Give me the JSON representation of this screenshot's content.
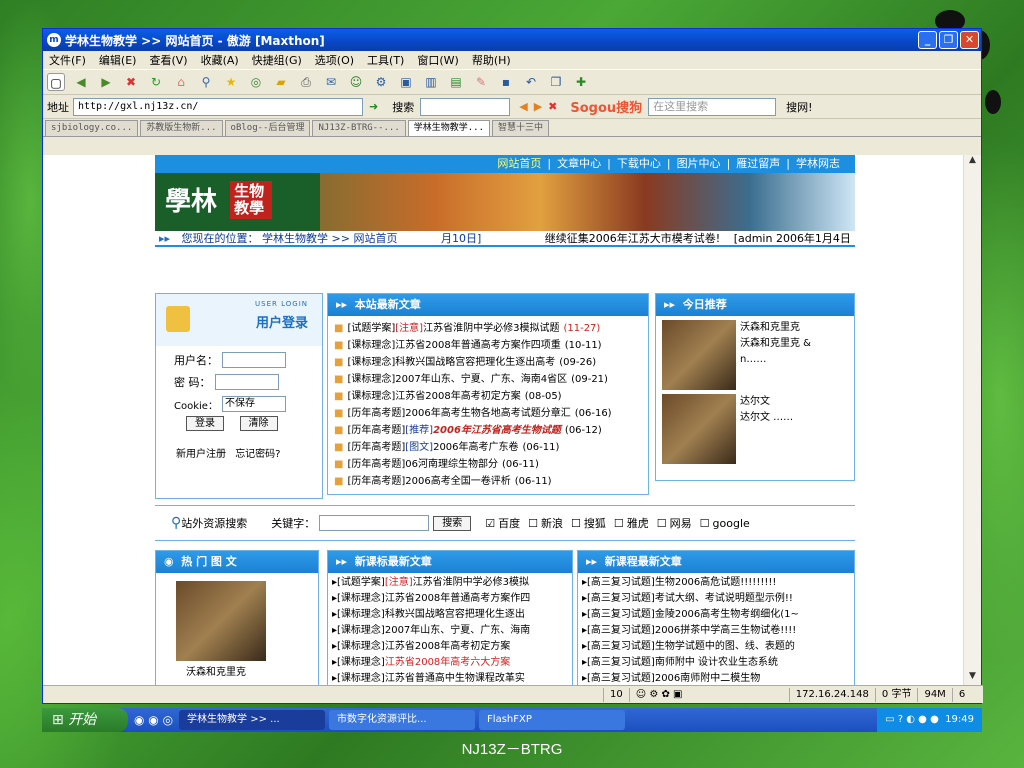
{
  "window": {
    "title": "学林生物教学 >> 网站首页 - 傲游 [Maxthon]",
    "menus": [
      "文件(F)",
      "编辑(E)",
      "查看(V)",
      "收藏(A)",
      "快捷组(G)",
      "选项(O)",
      "工具(T)",
      "窗口(W)",
      "帮助(H)"
    ],
    "address_label": "地址",
    "address_url": "http://gxl.nj13z.cn/",
    "search_label": "搜索",
    "sogou_logo": "Sogou搜狗",
    "sogou_placeholder": "在这里搜索",
    "sogou_button": "搜网!"
  },
  "tabs": [
    "sjbiology.co...",
    "苏教版生物新...",
    "oBlog--后台管理",
    "NJ13Z-BTRG--...",
    "学林生物教学...",
    "智慧十三中"
  ],
  "site": {
    "topnav": [
      "网站首页",
      "文章中心",
      "下载中心",
      "图片中心",
      "雁过留声",
      "学林网志"
    ],
    "logo_text": "學林",
    "logo_badge": "生物教學",
    "breadcrumb": "您现在的位置： 学林生物教学 >> 网站首页",
    "date_partial": "月10日]",
    "marquee": "继续征集2006年江苏大市模考试卷!",
    "admin": "[admin  2006年1月4日",
    "login": {
      "title_small": "USER LOGIN",
      "title": "用户登录",
      "username_label": "用户名：",
      "password_label": "密  码：",
      "cookie_label": "Cookie：",
      "cookie_value": "不保存",
      "login_btn": "登录",
      "clear_btn": "清除",
      "register": "新用户注册",
      "forgot": "忘记密码?"
    },
    "latest": {
      "title": "本站最新文章",
      "items": [
        {
          "pre": "[试题学案]",
          "tag": "[注意]",
          "text": "江苏省淮阴中学必修3模拟试题",
          "date": "(11-27)"
        },
        {
          "pre": "[课标理念]",
          "tag": "",
          "text": "江苏省2008年普通高考方案作四项重",
          "date": "(10-11)"
        },
        {
          "pre": "[课标理念]",
          "tag": "",
          "text": "科教兴国战略宫容把理化生逐出高考",
          "date": "(09-26)"
        },
        {
          "pre": "[课标理念]",
          "tag": "",
          "text": "2007年山东、宁夏、广东、海南4省区",
          "date": "(09-21)"
        },
        {
          "pre": "[课标理念]",
          "tag": "",
          "text": "江苏省2008年高考初定方案",
          "date": "(08-05)"
        },
        {
          "pre": "[历年高考题]",
          "tag": "",
          "text": "2006年高考生物各地高考试题分章汇",
          "date": "(06-16)"
        },
        {
          "pre": "[历年高考题]",
          "tag": "[推荐]",
          "text": "2006年江苏省高考生物试题",
          "date": "(06-12)"
        },
        {
          "pre": "[历年高考题]",
          "tag": "[图文]",
          "text": "2006年高考广东卷",
          "date": "(06-11)"
        },
        {
          "pre": "[历年高考题]",
          "tag": "",
          "text": "06河南理综生物部分",
          "date": "(06-11)"
        },
        {
          "pre": "[历年高考题]",
          "tag": "",
          "text": "2006高考全国一卷评析",
          "date": "(06-11)"
        }
      ]
    },
    "today": {
      "title": "今日推荐",
      "items": [
        {
          "title": "沃森和克里克",
          "desc": "沃森和克里克 &",
          "more": "n……"
        },
        {
          "title": "达尔文",
          "desc": "达尔文  ……",
          "more": ""
        }
      ]
    },
    "searchbar": {
      "label": "站外资源搜索",
      "kw_label": "关键字：",
      "button": "搜索",
      "engines": [
        {
          "name": "百度",
          "checked": true
        },
        {
          "name": "新浪",
          "checked": false
        },
        {
          "name": "搜狐",
          "checked": false
        },
        {
          "name": "雅虎",
          "checked": false
        },
        {
          "name": "网易",
          "checked": false
        },
        {
          "name": "google",
          "checked": false
        }
      ]
    },
    "hot": {
      "title": "热 门 图 文",
      "caption": "沃森和克里克"
    },
    "new_std": {
      "title": "新课标最新文章",
      "items": [
        {
          "pre": "[试题学案]",
          "tag": "[注意]",
          "text": "江苏省淮阴中学必修3模拟"
        },
        {
          "pre": "[课标理念]",
          "tag": "",
          "text": "江苏省2008年普通高考方案作四"
        },
        {
          "pre": "[课标理念]",
          "tag": "",
          "text": "科教兴国战略宫容把理化生逐出"
        },
        {
          "pre": "[课标理念]",
          "tag": "",
          "text": "2007年山东、宁夏、广东、海南"
        },
        {
          "pre": "[课标理念]",
          "tag": "",
          "text": "江苏省2008年高考初定方案"
        },
        {
          "pre": "[课标理念]",
          "tag": "",
          "text": "江苏省2008年高考六大方案",
          "red": true
        },
        {
          "pre": "[课标理念]",
          "tag": "",
          "text": "江苏省普通高中生物课程改革实"
        }
      ]
    },
    "new_course": {
      "title": "新课程最新文章",
      "items": [
        "[高三复习试题]生物2006高危试题!!!!!!!!!",
        "[高三复习试题]考试大纲、考试说明题型示例!!",
        "[高三复习试题]金陵2006高考生物考纲细化(1~",
        "[高三复习试题]2006拼茶中学高三生物试卷!!!!",
        "[高三复习试题]生物学试题中的图、线、表题的",
        "[高三复习试题]南师附中 设计农业生态系统",
        "[高三复习试题]2006南师附中二模生物"
      ]
    }
  },
  "status": {
    "left": "",
    "count": "10",
    "ip": "172.16.24.148",
    "bytes": "0 字节",
    "mem": "94M",
    "n": "6"
  },
  "taskbar": {
    "start": "开始",
    "items": [
      "学林生物教学 >> ...",
      "市数字化资源评比...",
      "FlashFXP"
    ],
    "clock": "19:49"
  },
  "footer": "NJ13Z－BTRG"
}
